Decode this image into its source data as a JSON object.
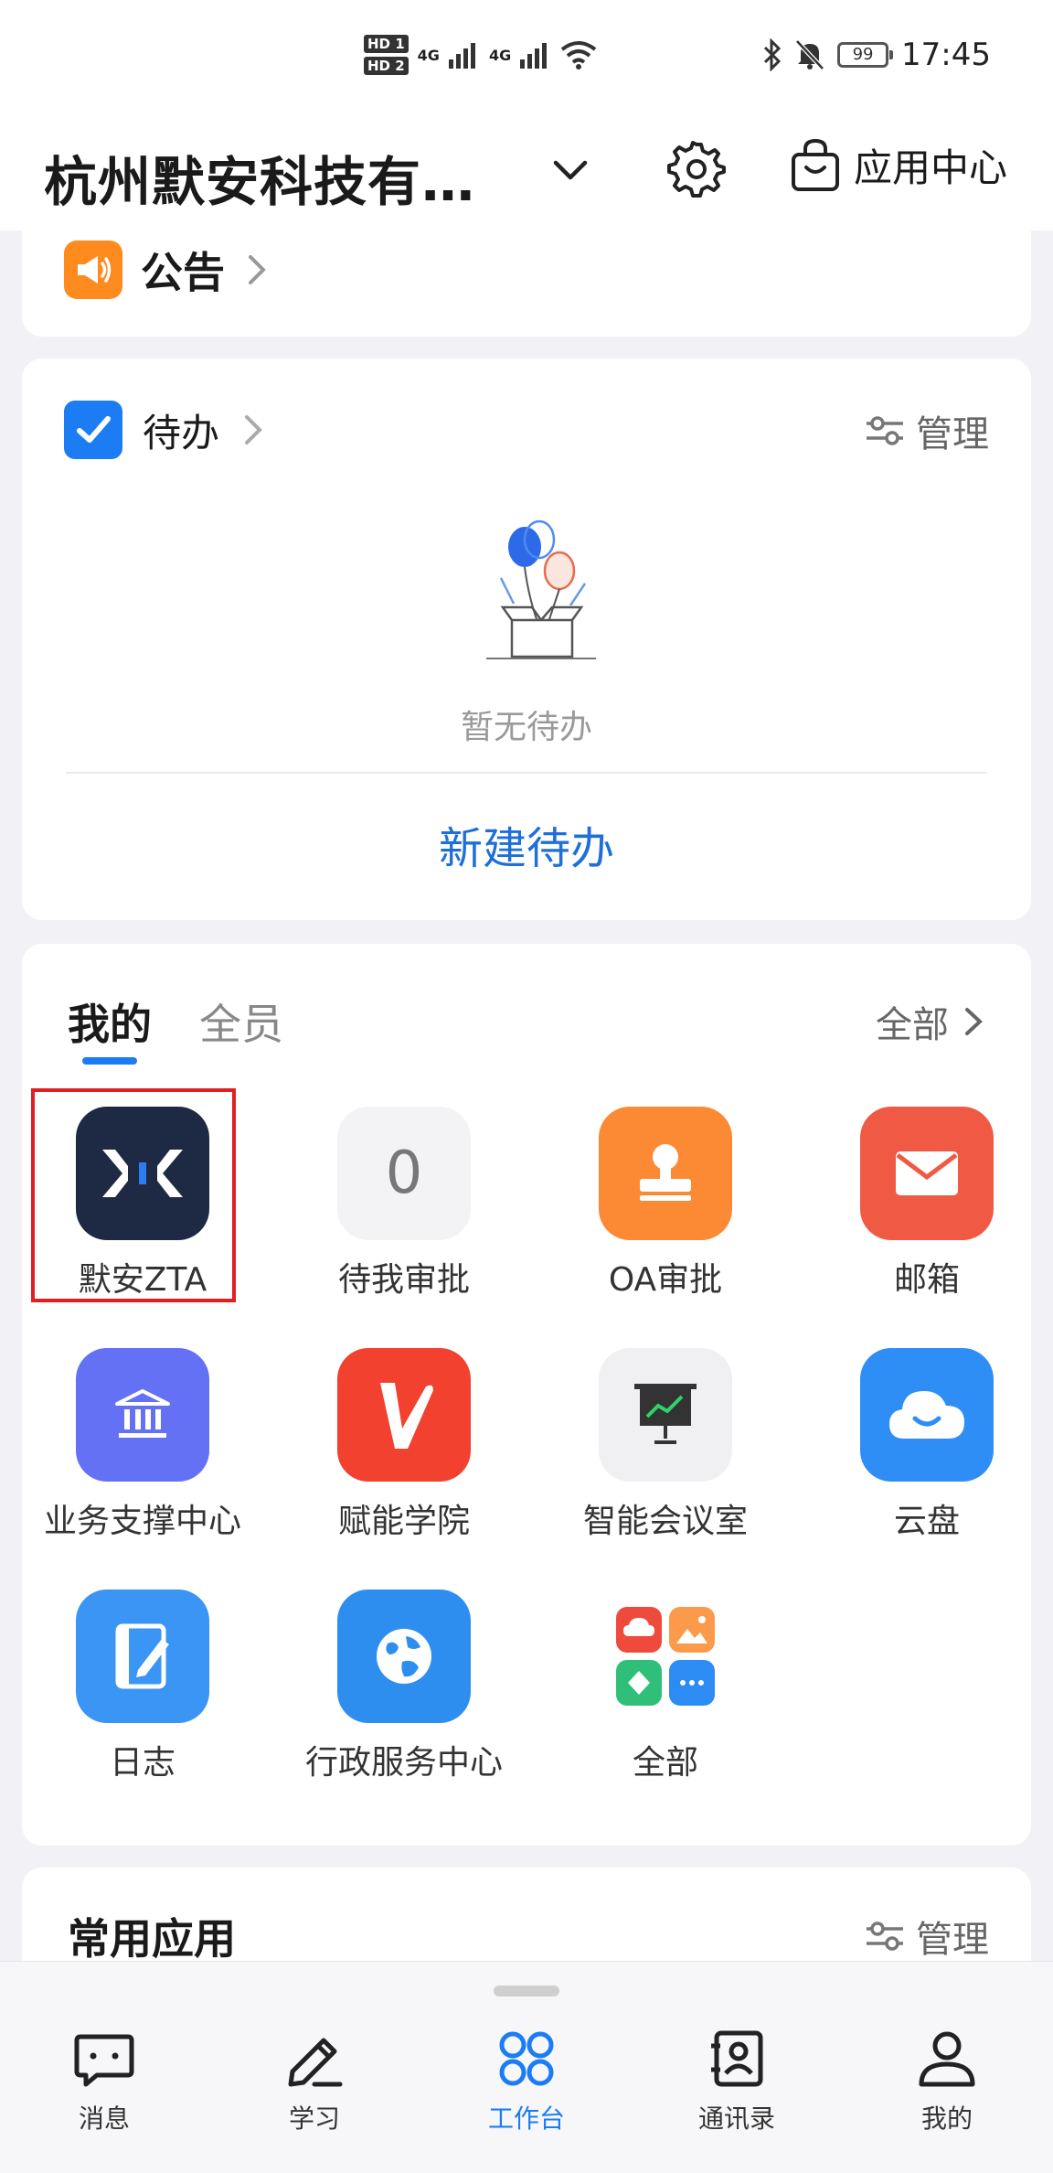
{
  "statusbar": {
    "network": [
      "4G",
      "4G"
    ],
    "sim_labels": [
      "HD 1",
      "HD 2"
    ],
    "battery": "99",
    "time": "17:45"
  },
  "header": {
    "company": "杭州默安科技有…",
    "app_center": "应用中心"
  },
  "announcement": {
    "label": "公告"
  },
  "todo": {
    "title": "待办",
    "manage": "管理",
    "empty": "暂无待办",
    "new": "新建待办"
  },
  "apps": {
    "tabs": [
      "我的",
      "全员"
    ],
    "all": "全部",
    "items": [
      {
        "label": "默安ZTA",
        "icon": "zta-logo-icon",
        "color": "#1e2a44"
      },
      {
        "label": "待我审批",
        "icon": "zero-count-icon",
        "count": "0",
        "color": "#f3f3f5"
      },
      {
        "label": "OA审批",
        "icon": "stamp-icon",
        "color": "#fc8a34"
      },
      {
        "label": "邮箱",
        "icon": "mail-icon",
        "color": "#f05a45"
      },
      {
        "label": "业务支撑中心",
        "icon": "bank-icon",
        "color": "#6471f5"
      },
      {
        "label": "赋能学院",
        "icon": "v-logo-icon",
        "color": "#f2412e"
      },
      {
        "label": "智能会议室",
        "icon": "presentation-icon",
        "color": "#f0f0f2"
      },
      {
        "label": "云盘",
        "icon": "cloud-icon",
        "color": "#2f8ef6"
      },
      {
        "label": "日志",
        "icon": "log-icon",
        "color": "#3a95f5"
      },
      {
        "label": "行政服务中心",
        "icon": "globe-icon",
        "color": "#2e8ef0"
      },
      {
        "label": "全部",
        "icon": "all-apps-icon",
        "color": "#ffffff"
      }
    ]
  },
  "common": {
    "title": "常用应用",
    "manage": "管理"
  },
  "nav": {
    "items": [
      {
        "label": "消息"
      },
      {
        "label": "学习"
      },
      {
        "label": "工作台"
      },
      {
        "label": "通讯录"
      },
      {
        "label": "我的"
      }
    ],
    "active": "工作台"
  }
}
